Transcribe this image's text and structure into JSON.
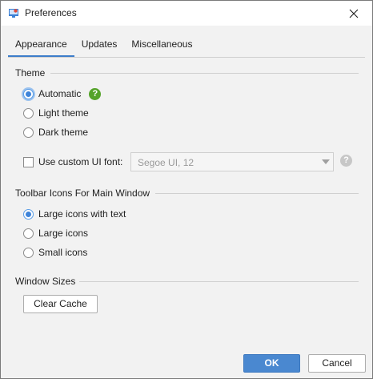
{
  "window": {
    "title": "Preferences",
    "close_icon": "close-icon",
    "app_icon": "preferences-app-icon"
  },
  "tabs": [
    {
      "label": "Appearance",
      "active": true
    },
    {
      "label": "Updates",
      "active": false
    },
    {
      "label": "Miscellaneous",
      "active": false
    }
  ],
  "theme": {
    "heading": "Theme",
    "options": [
      {
        "label": "Automatic",
        "checked": true
      },
      {
        "label": "Light theme",
        "checked": false
      },
      {
        "label": "Dark theme",
        "checked": false
      }
    ],
    "help_icon": "help-question-icon"
  },
  "custom_font": {
    "label": "Use custom UI font:",
    "checked": false,
    "value": "Segoe UI, 12",
    "enabled": false
  },
  "toolbar_icons": {
    "heading": "Toolbar Icons For Main Window",
    "options": [
      {
        "label": "Large icons with text",
        "checked": true
      },
      {
        "label": "Large icons",
        "checked": false
      },
      {
        "label": "Small icons",
        "checked": false
      }
    ]
  },
  "window_sizes": {
    "heading": "Window Sizes",
    "clear_cache_label": "Clear Cache"
  },
  "footer": {
    "ok_label": "OK",
    "cancel_label": "Cancel"
  },
  "colors": {
    "accent": "#3f84d9",
    "ok_button": "#4a88d0",
    "help_green": "#55a32a",
    "help_gray": "#c7c7c7"
  }
}
